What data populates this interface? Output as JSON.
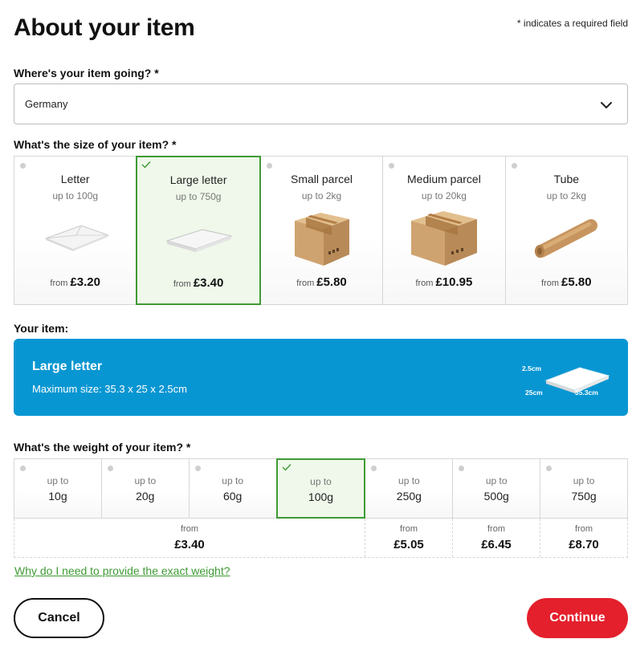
{
  "header": {
    "title": "About your item",
    "required_note": "* indicates a required field"
  },
  "destination": {
    "label": "Where's your item going? *",
    "selected": "Germany",
    "chevron_icon": "chevron-down-icon"
  },
  "size": {
    "label": "What's the size of your item? *",
    "options": [
      {
        "name": "Letter",
        "limit": "up to 100g",
        "from": "from",
        "price": "£3.20",
        "icon": "envelope-icon",
        "selected": false
      },
      {
        "name": "Large letter",
        "limit": "up to 750g",
        "from": "from",
        "price": "£3.40",
        "icon": "large-letter-icon",
        "selected": true
      },
      {
        "name": "Small parcel",
        "limit": "up to 2kg",
        "from": "from",
        "price": "£5.80",
        "icon": "box-icon",
        "selected": false
      },
      {
        "name": "Medium parcel",
        "limit": "up to 20kg",
        "from": "from",
        "price": "£10.95",
        "icon": "box-icon",
        "selected": false
      },
      {
        "name": "Tube",
        "limit": "up to 2kg",
        "from": "from",
        "price": "£5.80",
        "icon": "tube-icon",
        "selected": false
      }
    ]
  },
  "item": {
    "label": "Your item:",
    "title": "Large letter",
    "subtitle": "Maximum size: 35.3 x 25 x 2.5cm",
    "dim_height": "2.5cm",
    "dim_width": "25cm",
    "dim_length": "35.3cm",
    "bg_color": "#0896d2"
  },
  "weight": {
    "label": "What's the weight of your item? *",
    "options": [
      {
        "up": "up to",
        "value": "10g",
        "selected": false
      },
      {
        "up": "up to",
        "value": "20g",
        "selected": false
      },
      {
        "up": "up to",
        "value": "60g",
        "selected": false
      },
      {
        "up": "up to",
        "value": "100g",
        "selected": true
      },
      {
        "up": "up to",
        "value": "250g",
        "selected": false
      },
      {
        "up": "up to",
        "value": "500g",
        "selected": false
      },
      {
        "up": "up to",
        "value": "750g",
        "selected": false
      }
    ],
    "prices": [
      {
        "from": "from",
        "price": "£3.40"
      },
      {
        "from": "from",
        "price": "£5.05"
      },
      {
        "from": "from",
        "price": "£6.45"
      },
      {
        "from": "from",
        "price": "£8.70"
      }
    ]
  },
  "help_link": "Why do I need to provide the exact weight?",
  "actions": {
    "cancel": "Cancel",
    "continue": "Continue"
  },
  "colors": {
    "accent_green": "#3f9a35",
    "primary_red": "#e3202c",
    "banner_blue": "#0896d2"
  }
}
